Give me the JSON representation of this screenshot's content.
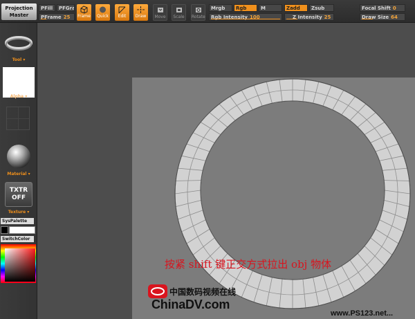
{
  "top_shelf": {
    "project_master": "Projection Master",
    "pfill": "PFill",
    "pfgra": "PFGra",
    "pframe_label": "PFrame",
    "pframe_value": "25",
    "frame": "Frame",
    "quick": "Quick",
    "edit": "Edit",
    "draw": "Draw",
    "move": "Move",
    "scale": "Scale",
    "rotate": "Rotate",
    "mrgb": "Mrgb",
    "rgb": "Rgb",
    "m": "M",
    "zadd": "Zadd",
    "zsub": "Zsub",
    "rgb_intensity_label": "Rgb Intensity",
    "rgb_intensity_value": "100",
    "z_intensity_label": "Z Intensity",
    "z_intensity_value": "25",
    "focal_shift_label": "Focal Shift",
    "focal_shift_value": "0",
    "draw_size_label": "Draw Size",
    "draw_size_value": "64"
  },
  "left_tray": {
    "tool": "Tool",
    "alpha": "Alpha",
    "material": "Material",
    "txtr_line1": "TXTR",
    "txtr_line2": "OFF",
    "texture": "Texture",
    "syspalette": "SysPalette",
    "switchcolor": "SwitchColor"
  },
  "canvas": {
    "caption": "按紧 shift 键正交方式拉出 obj 物体",
    "watermark_cn": "中国数码视频在线",
    "watermark_site": "ChinaDV.com",
    "watermark_site2": "www.PS123.net..."
  },
  "colors": {
    "accent": "#f0901c",
    "caption": "#d9141e"
  }
}
